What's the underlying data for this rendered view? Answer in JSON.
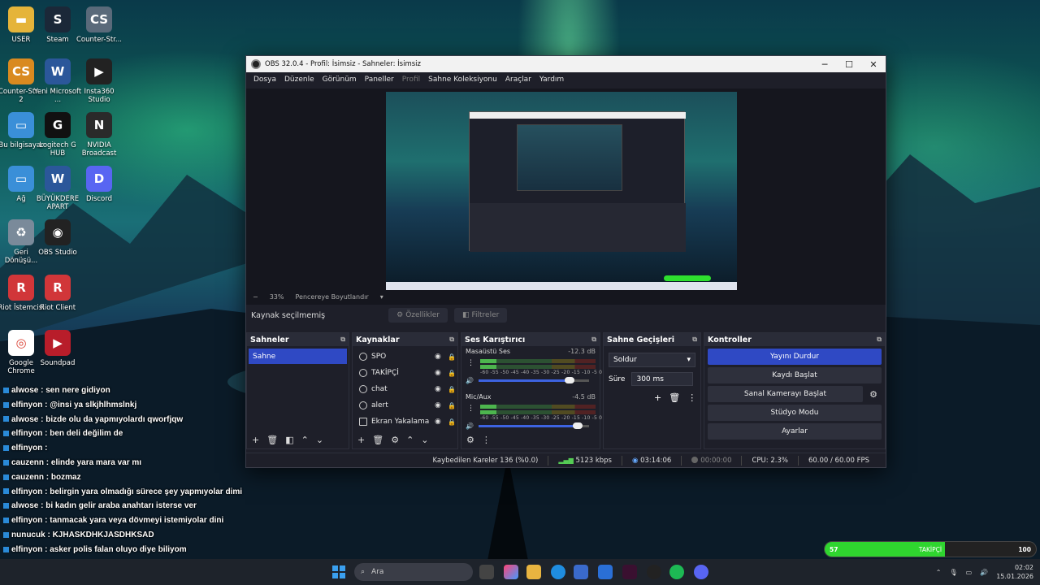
{
  "desktop": {
    "icons": [
      {
        "label": "USER",
        "color": "#e5b43a",
        "glyph": "▬"
      },
      {
        "label": "Steam",
        "color": "#1b2838",
        "glyph": "S"
      },
      {
        "label": "Counter-Str...",
        "color": "#5a6a7a",
        "glyph": "CS"
      },
      {
        "label": "Counter-Str... 2",
        "color": "#d98a20",
        "glyph": "CS"
      },
      {
        "label": "Yeni Microsoft ...",
        "color": "#2b579a",
        "glyph": "W"
      },
      {
        "label": "Insta360 Studio",
        "color": "#222222",
        "glyph": "▶"
      },
      {
        "label": "Bu bilgisayar",
        "color": "#3a8fd8",
        "glyph": "▭"
      },
      {
        "label": "Logitech G HUB",
        "color": "#111111",
        "glyph": "G"
      },
      {
        "label": "NVIDIA Broadcast",
        "color": "#2a2a2a",
        "glyph": "N"
      },
      {
        "label": "Ağ",
        "color": "#3a8fd8",
        "glyph": "▭"
      },
      {
        "label": "BÜYÜKDERE APART",
        "color": "#2b579a",
        "glyph": "W"
      },
      {
        "label": "Discord",
        "color": "#5865f2",
        "glyph": "D"
      },
      {
        "label": "Geri Dönüşü...",
        "color": "#7a8a9a",
        "glyph": "♻"
      },
      {
        "label": "OBS Studio",
        "color": "#222222",
        "glyph": "◉"
      },
      {
        "label": "Riot İstemcisi",
        "color": "#d13639",
        "glyph": "R"
      },
      {
        "label": "Riot Client",
        "color": "#d13639",
        "glyph": "R"
      },
      {
        "label": "Google Chrome",
        "color": "#ffffff",
        "glyph": "◎"
      },
      {
        "label": "Soundpad",
        "color": "#b81d2a",
        "glyph": "▶"
      }
    ]
  },
  "chat": [
    {
      "user": "alwose",
      "msg": "sen nere gidiyon"
    },
    {
      "user": "elfinyon",
      "msg": "@insi ya slkjhlhmslnkj"
    },
    {
      "user": "alwose",
      "msg": "bizde olu da yapmıyolardı qworfjqw"
    },
    {
      "user": "elfinyon",
      "msg": "ben deli değilim de"
    },
    {
      "user": "elfinyon",
      "msg": ""
    },
    {
      "user": "cauzenn",
      "msg": "elinde yara mara var mı"
    },
    {
      "user": "cauzenn",
      "msg": "bozmaz"
    },
    {
      "user": "elfinyon",
      "msg": "belirgin yara olmadığı sürece şey yapmıyolar dimi"
    },
    {
      "user": "alwose",
      "msg": "bi kadın gelir araba anahtarı isterse ver"
    },
    {
      "user": "elfinyon",
      "msg": "tanmacak yara veya dövmeyi istemiyolar dini"
    },
    {
      "user": "nunucuk",
      "msg": "KJHASKDHKJASDHKSAD"
    },
    {
      "user": "elfinyon",
      "msg": "asker polis falan oluyo diye biliyom"
    }
  ],
  "obs": {
    "title": "OBS 32.0.4 - Profil: İsimsiz - Sahneler: İsimsiz",
    "menu": [
      "Dosya",
      "Düzenle",
      "Görünüm",
      "Paneller",
      "Profil",
      "Sahne Koleksiyonu",
      "Araçlar",
      "Yardım"
    ],
    "zoom": "33%",
    "zoom_mode": "Pencereye Boyutlandır",
    "source_status": "Kaynak seçilmemiş",
    "properties_label": "Özellikler",
    "filters_label": "Filtreler",
    "docks": {
      "scenes": {
        "title": "Sahneler",
        "items": [
          "Sahne"
        ]
      },
      "sources": {
        "title": "Kaynaklar",
        "items": [
          {
            "name": "SPO",
            "type": "browser"
          },
          {
            "name": "TAKİPÇİ",
            "type": "browser"
          },
          {
            "name": "chat",
            "type": "browser"
          },
          {
            "name": "alert",
            "type": "browser"
          },
          {
            "name": "Ekran Yakalama",
            "type": "monitor"
          }
        ]
      },
      "mixer": {
        "title": "Ses Karıştırıcı",
        "ticks": "-60 -55 -50 -45 -40 -35 -30 -25 -20 -15 -10 -5 0",
        "channels": [
          {
            "name": "Masaüstü Ses",
            "db": "-12.3 dB",
            "volume": 0.82
          },
          {
            "name": "Mic/Aux",
            "db": "-4.5 dB",
            "volume": 0.9
          }
        ]
      },
      "transitions": {
        "title": "Sahne Geçişleri",
        "type": "Soldur",
        "duration_label": "Süre",
        "duration": "300 ms"
      },
      "controls": {
        "title": "Kontroller",
        "stop_stream": "Yayını Durdur",
        "start_record": "Kaydı Başlat",
        "virtual_cam": "Sanal Kamerayı Başlat",
        "studio_mode": "Stüdyo Modu",
        "settings": "Ayarlar"
      }
    },
    "status": {
      "dropped": "Kaybedilen Kareler 136 (%0.0)",
      "bitrate": "5123 kbps",
      "stream_time": "03:14:06",
      "rec_time": "00:00:00",
      "cpu": "CPU: 2.3%",
      "fps": "60.00 / 60.00 FPS"
    }
  },
  "overlay_progress": {
    "left": "57",
    "center": "TAKİPÇİ",
    "right": "100",
    "value": 0.57
  },
  "taskbar": {
    "search_placeholder": "Ara",
    "time": "02:02",
    "date": "15.01.2026"
  },
  "colors": {
    "accent": "#2f49c4",
    "meter_green": "#2f9a3c",
    "progress": "#2fd52f"
  }
}
